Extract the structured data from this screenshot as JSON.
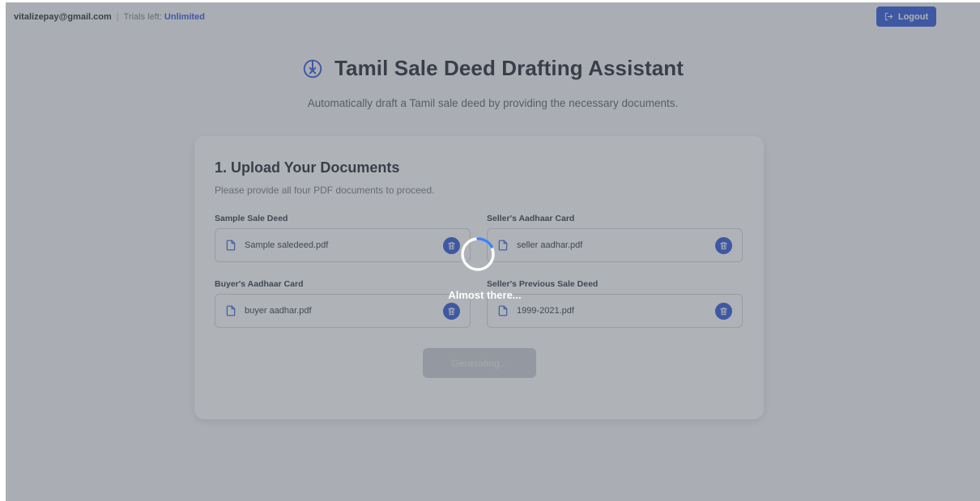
{
  "topbar": {
    "email": "vitalizepay@gmail.com",
    "separator": "|",
    "trials_label": "Trials left:",
    "trials_value": "Unlimited",
    "logout_label": "Logout"
  },
  "hero": {
    "title": "Tamil Sale Deed Drafting Assistant",
    "subtitle": "Automatically draft a Tamil sale deed by providing the necessary documents."
  },
  "upload": {
    "heading": "1. Upload Your Documents",
    "description": "Please provide all four PDF documents to proceed.",
    "fields": [
      {
        "label": "Sample Sale Deed",
        "file": "Sample saledeed.pdf"
      },
      {
        "label": "Seller's Aadhaar Card",
        "file": "seller aadhar.pdf"
      },
      {
        "label": "Buyer's Aadhaar Card",
        "file": "buyer aadhar.pdf"
      },
      {
        "label": "Seller's Previous Sale Deed",
        "file": "1999-2021.pdf"
      }
    ],
    "generate_label": "Generating..."
  },
  "loading": {
    "text": "Almost there..."
  },
  "icons": {
    "title_icon": "timer-cancel-icon",
    "file_icon": "file-icon",
    "delete_icon": "trash-icon",
    "logout_icon": "logout-icon"
  },
  "colors": {
    "accent": "#1e4bd8",
    "overlay": "#5f656e",
    "background": "#f5f7fa"
  }
}
